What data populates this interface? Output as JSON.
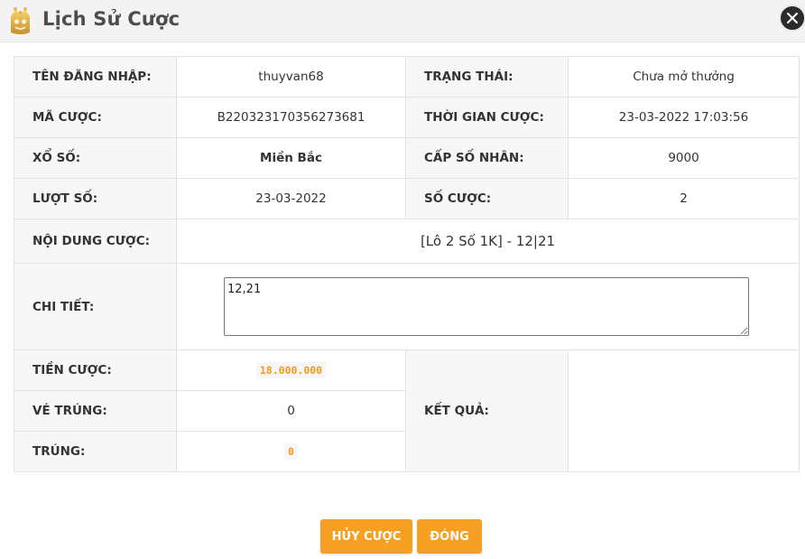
{
  "header": {
    "title": "Lịch Sử Cược"
  },
  "rows": {
    "username_label": "TÊN ĐĂNG NHẬP:",
    "username": "thuyvan68",
    "status_label": "TRẠNG THÁI:",
    "status": "Chưa mở thưởng",
    "bet_code_label": "MÃ CƯỢC:",
    "bet_code": "B220323170356273681",
    "bet_time_label": "THỜI GIAN CƯỢC:",
    "bet_time": "23-03-2022 17:03:56",
    "lottery_label": "XỔ SỐ:",
    "lottery": "Miền Bắc",
    "multiplier_label": "CẤP SỐ NHÂN:",
    "multiplier": "9000",
    "draw_label": "LƯỢT SỐ:",
    "draw": "23-03-2022",
    "bet_count_label": "SỐ CƯỢC:",
    "bet_count": "2",
    "content_label": "NỘI DUNG CƯỢC:",
    "content": "[Lô 2 Số 1K] - 12|21",
    "detail_label": "CHI TIẾT:",
    "detail": "12,21",
    "amount_label": "TIỀN CƯỢC:",
    "amount": "18.000.000",
    "result_label": "KẾT QUẢ:",
    "result": "",
    "winning_tickets_label": "VÉ TRÚNG:",
    "winning_tickets": "0",
    "winnings_label": "TRÚNG:",
    "winnings": "0"
  },
  "buttons": {
    "cancel_bet": "HỦY CƯỢC",
    "close": "ĐÓNG"
  },
  "colors": {
    "accent": "#f5a023",
    "amount_text": "#f39a1e",
    "header_bg": "#f3f3f3"
  },
  "icons": {
    "logo": "crown-logo-icon",
    "close": "close-icon"
  }
}
